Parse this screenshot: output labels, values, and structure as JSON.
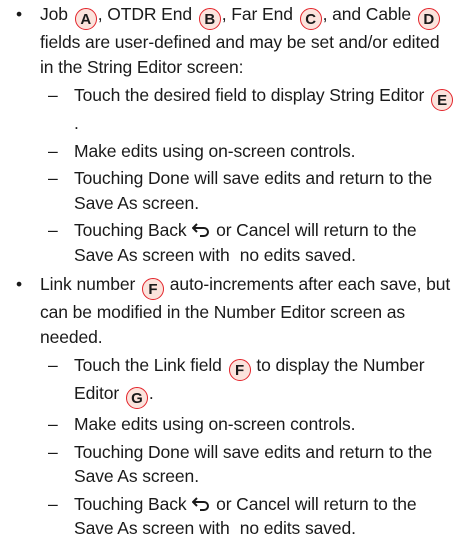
{
  "bullets": [
    {
      "text_parts": [
        "Job",
        ", OTDR End",
        ", Far End",
        ", and Cable"
      ],
      "callouts": [
        "A",
        "B",
        "C",
        "D"
      ],
      "rest": " fields are user-defined and may be set and/or edited in the String Editor screen:",
      "sub": [
        {
          "text": "Touch the desired field to display String Editor",
          "callout": "E",
          "end": "."
        },
        {
          "text": "Make edits using on-screen controls."
        },
        {
          "text": "Touching Done will save edits and return to the Save As screen."
        },
        {
          "pre": "Touching Back",
          "icon": "back-arrow-icon",
          "post": "or Cancel will return to the Save As  screen with",
          "tail": "no edits saved."
        }
      ]
    },
    {
      "pre": "Link number",
      "callout": "F",
      "post": " auto-increments after each save, but can be modified in the Number Editor screen as needed.",
      "sub": [
        {
          "text": "Touch the Link field",
          "callout": "F",
          "mid": " to display the Number Editor",
          "callout2": "G",
          "end": "."
        },
        {
          "text": "Make edits using on-screen controls."
        },
        {
          "text": "Touching Done will save edits and return to the Save As screen."
        },
        {
          "pre": "Touching Back",
          "icon": "back-arrow-icon",
          "post": "or Cancel will return to the Save As  screen with",
          "tail": "no edits saved."
        }
      ]
    }
  ],
  "symbols": {
    "bullet": "•",
    "dash": "–"
  },
  "colors": {
    "callout_border": "#e3242b",
    "callout_fill": "#fbe3dc",
    "text": "#1a1a1a"
  }
}
